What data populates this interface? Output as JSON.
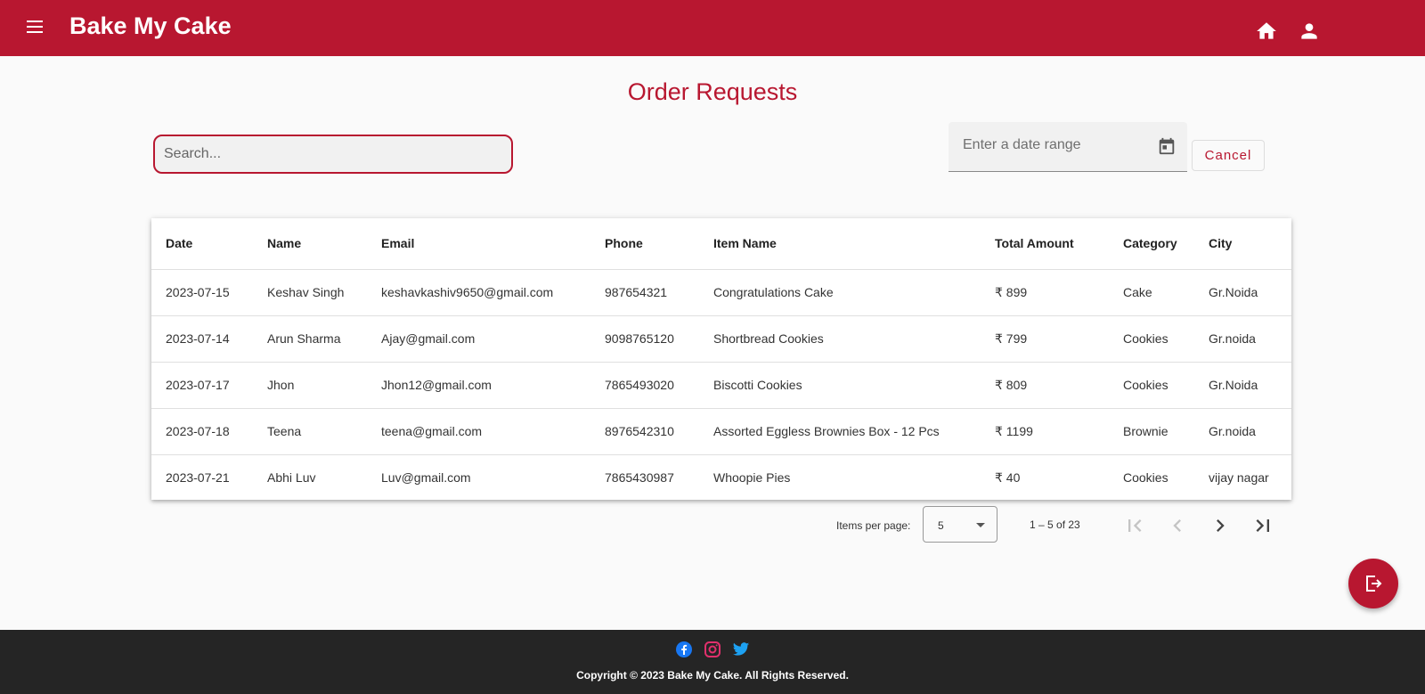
{
  "header": {
    "brand": "Bake My Cake",
    "icons": [
      "menu-icon",
      "home-icon",
      "person-icon"
    ]
  },
  "page": {
    "title": "Order Requests"
  },
  "filters": {
    "search_placeholder": "Search...",
    "date_range_placeholder": "Enter a date range",
    "cancel_label": "Cancel"
  },
  "table": {
    "columns": [
      "Date",
      "Name",
      "Email",
      "Phone",
      "Item Name",
      "Total Amount",
      "Category",
      "City"
    ],
    "rows": [
      [
        "2023-07-15",
        "Keshav Singh",
        "keshavkashiv9650@gmail.com",
        "987654321",
        "Congratulations Cake",
        "₹ 899",
        "Cake",
        "Gr.Noida"
      ],
      [
        "2023-07-14",
        "Arun Sharma",
        "Ajay@gmail.com",
        "9098765120",
        "Shortbread Cookies",
        "₹ 799",
        "Cookies",
        "Gr.noida"
      ],
      [
        "2023-07-17",
        "Jhon",
        "Jhon12@gmail.com",
        "7865493020",
        "Biscotti Cookies",
        "₹ 809",
        "Cookies",
        "Gr.Noida"
      ],
      [
        "2023-07-18",
        "Teena",
        "teena@gmail.com",
        "8976542310",
        "Assorted Eggless Brownies Box - 12 Pcs",
        "₹ 1199",
        "Brownie",
        "Gr.noida"
      ],
      [
        "2023-07-21",
        "Abhi Luv",
        "Luv@gmail.com",
        "7865430987",
        "Whoopie Pies",
        "₹ 40",
        "Cookies",
        "vijay nagar"
      ]
    ]
  },
  "paginator": {
    "items_per_page_label": "Items per page:",
    "items_per_page_value": "5",
    "range_label": "1 – 5 of 23"
  },
  "footer": {
    "copyright": "Copyright © 2023 Bake My Cake. All Rights Reserved.",
    "social_icons": [
      "facebook-icon",
      "instagram-icon",
      "twitter-icon"
    ]
  },
  "colors": {
    "primary": "#b81730",
    "footer_bg": "#252525",
    "page_bg": "#fafafa"
  }
}
